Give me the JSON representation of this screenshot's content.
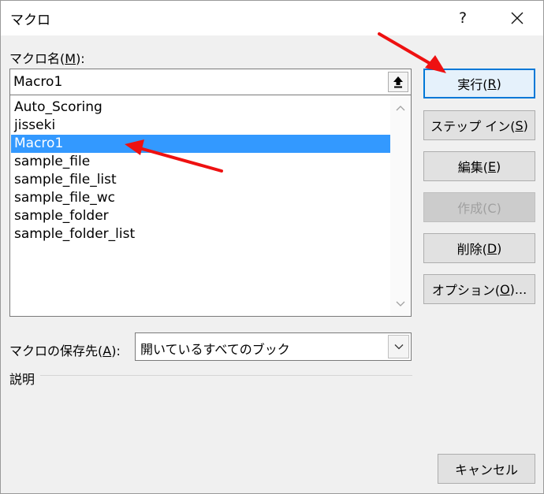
{
  "window": {
    "title": "マクロ",
    "help_label": "?"
  },
  "macro_name": {
    "label": "マクロ名(",
    "label_key": "M",
    "label_end": "):",
    "value": "Macro1"
  },
  "macro_list": {
    "items": [
      "Auto_Scoring",
      "jisseki",
      "Macro1",
      "sample_file",
      "sample_file_list",
      "sample_file_wc",
      "sample_folder",
      "sample_folder_list"
    ],
    "selected": "Macro1"
  },
  "buttons": {
    "run": {
      "label": "実行(",
      "key": "R",
      "end": ")"
    },
    "step_in": {
      "label": "ステップ イン(",
      "key": "S",
      "end": ")"
    },
    "edit": {
      "label": "編集(",
      "key": "E",
      "end": ")"
    },
    "create": {
      "label": "作成(C)"
    },
    "delete": {
      "label": "削除(",
      "key": "D",
      "end": ")"
    },
    "options": {
      "label": "オプション(",
      "key": "O",
      "end": ")..."
    },
    "cancel": {
      "label": "キャンセル"
    }
  },
  "macro_location": {
    "label": "マクロの保存先(",
    "label_key": "A",
    "label_end": "):",
    "value": "開いているすべてのブック"
  },
  "description": {
    "label": "説明"
  },
  "colors": {
    "selection": "#3399ff",
    "default_button_border": "#0078d7",
    "annotation_arrow": "#ee1111"
  }
}
